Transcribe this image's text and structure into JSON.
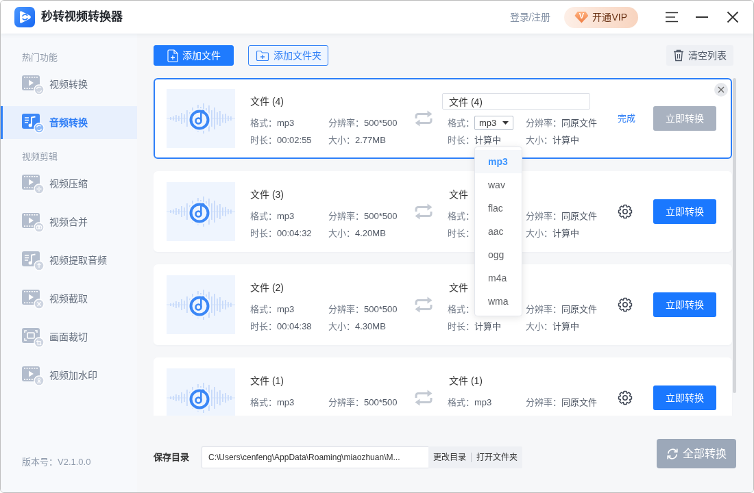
{
  "window": {
    "title": "秒转视频转换器",
    "login_link": "登录/注册",
    "vip_button": {
      "badge": "V",
      "label": "开通VIP"
    }
  },
  "sidebar": {
    "sections": [
      {
        "title": "热门功能",
        "items": [
          {
            "label": "视频转换",
            "kind": "convert",
            "selected": false
          },
          {
            "label": "音频转换",
            "kind": "audio",
            "selected": true
          }
        ]
      },
      {
        "title": "视频剪辑",
        "items": [
          {
            "label": "视频压缩",
            "kind": "compress",
            "selected": false
          },
          {
            "label": "视频合并",
            "kind": "merge",
            "selected": false
          },
          {
            "label": "视频提取音频",
            "kind": "extract",
            "selected": false
          },
          {
            "label": "视频截取",
            "kind": "cut",
            "selected": false
          },
          {
            "label": "画面裁切",
            "kind": "crop",
            "selected": false
          },
          {
            "label": "视频加水印",
            "kind": "watermark",
            "selected": false
          }
        ]
      }
    ],
    "version": "版本号：V2.1.0.0"
  },
  "toolbar": {
    "add_file": "添加文件",
    "add_folder": "添加文件夹",
    "clear_list": "清空列表"
  },
  "files": [
    {
      "selected": true,
      "source": {
        "name": "文件 (4)",
        "fields": [
          {
            "label": "格式：",
            "value": "mp3"
          },
          {
            "label": "分辨率：",
            "value": "500*500"
          },
          {
            "label": "时长：",
            "value": "00:02:55"
          },
          {
            "label": "大小：",
            "value": "2.77MB"
          }
        ]
      },
      "output": {
        "name": "文件 (4)",
        "fields": [
          {
            "kind": "select",
            "label": "格式：",
            "value": "mp3",
            "expanded": true,
            "options": [
              {
                "label": "mp3",
                "selected": true
              },
              {
                "label": "wav",
                "selected": false
              },
              {
                "label": "flac",
                "selected": false
              },
              {
                "label": "aac",
                "selected": false
              },
              {
                "label": "ogg",
                "selected": false
              },
              {
                "label": "m4a",
                "selected": false
              },
              {
                "label": "wma",
                "selected": false
              }
            ]
          },
          {
            "kind": "text",
            "label": "分辨率：",
            "value": "同原文件"
          },
          {
            "kind": "text",
            "label": "时长：",
            "value": "计算中"
          },
          {
            "kind": "text",
            "label": "大小：",
            "value": "计算中"
          }
        ]
      },
      "done_link": "完成",
      "convert_button": {
        "label": "立即转换",
        "disabled": true
      }
    },
    {
      "selected": false,
      "source": {
        "name": "文件 (3)",
        "fields": [
          {
            "label": "格式：",
            "value": "mp3"
          },
          {
            "label": "分辨率：",
            "value": "500*500"
          },
          {
            "label": "时长：",
            "value": "00:04:32"
          },
          {
            "label": "大小：",
            "value": "4.20MB"
          }
        ]
      },
      "output": {
        "name": "文件",
        "fields": [
          {
            "kind": "text",
            "label": "格式："
          },
          {
            "kind": "text",
            "label": "分辨率：",
            "value": "同原文件"
          },
          {
            "kind": "text",
            "label": "时长："
          },
          {
            "kind": "text",
            "label": "大小：",
            "value": "计算中"
          }
        ]
      },
      "convert_button": {
        "label": "立即转换",
        "disabled": false
      }
    },
    {
      "selected": false,
      "source": {
        "name": "文件 (2)",
        "fields": [
          {
            "label": "格式：",
            "value": "mp3"
          },
          {
            "label": "分辨率：",
            "value": "500*500"
          },
          {
            "label": "时长：",
            "value": "00:04:38"
          },
          {
            "label": "大小：",
            "value": "4.30MB"
          }
        ]
      },
      "output": {
        "name": "文件",
        "fields": [
          {
            "kind": "text",
            "label": "格式："
          },
          {
            "kind": "text",
            "label": "分辨率：",
            "value": "同原文件"
          },
          {
            "kind": "text",
            "label": "时长：",
            "value": "计算中"
          },
          {
            "kind": "text",
            "label": "大小：",
            "value": "计算中"
          }
        ]
      },
      "convert_button": {
        "label": "立即转换",
        "disabled": false
      }
    },
    {
      "selected": false,
      "source": {
        "name": "文件 (1)",
        "fields": [
          {
            "label": "格式：",
            "value": "mp3"
          },
          {
            "label": "分辨率：",
            "value": "500*500"
          }
        ]
      },
      "output": {
        "name": "文件 (1)",
        "fields": [
          {
            "kind": "text",
            "label": "格式：",
            "value": "mp3"
          },
          {
            "kind": "text",
            "label": "分辨率：",
            "value": "同原文件"
          }
        ]
      },
      "convert_button": {
        "label": "立即转换",
        "disabled": false
      }
    }
  ],
  "save_bar": {
    "label": "保存目录",
    "path": "C:\\Users\\cenfeng\\AppData\\Roaming\\miaozhuan\\M...",
    "change_dir": "更改目录",
    "open_folder": "打开文件夹",
    "convert_all": {
      "label": "全部转换",
      "disabled": true
    }
  }
}
